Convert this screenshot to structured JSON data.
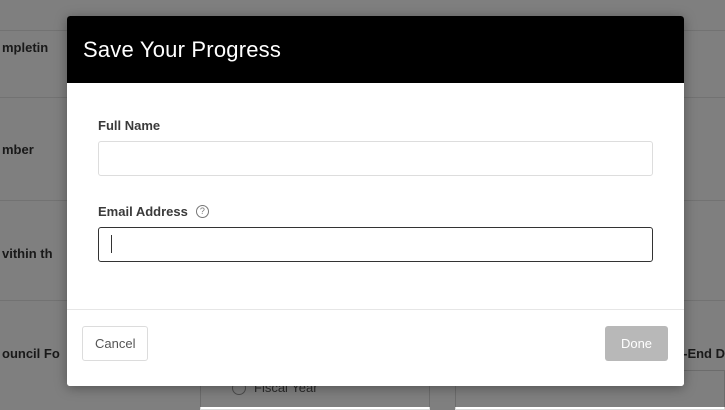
{
  "background": {
    "labels": [
      {
        "text": "mpletin"
      },
      {
        "text": "mber"
      },
      {
        "text": "vithin th"
      },
      {
        "text": "ouncil Fo"
      }
    ],
    "right_label": "-End D",
    "radio_label": "Fiscal Year"
  },
  "modal": {
    "title": "Save Your Progress",
    "fields": {
      "full_name": {
        "label": "Full Name",
        "value": "",
        "placeholder": ""
      },
      "email": {
        "label": "Email Address",
        "help_icon_glyph": "?",
        "value": "",
        "placeholder": ""
      }
    },
    "footer": {
      "cancel_label": "Cancel",
      "done_label": "Done"
    }
  },
  "icons": {
    "help": "question-circle-icon"
  },
  "colors": {
    "header_bg": "#000000",
    "header_text": "#ffffff",
    "done_button_bg": "#b8b8b8",
    "overlay": "rgba(0,0,0,0.5)"
  }
}
